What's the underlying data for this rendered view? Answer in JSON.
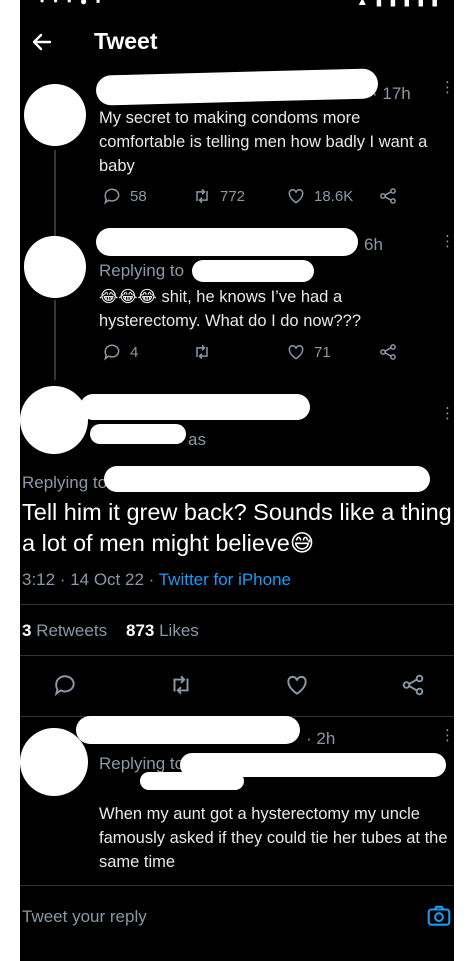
{
  "status_bar": {
    "left": "• • • ⦁ ▪",
    "right": "▲ ▮ ▮ ▮ ▮ ▮"
  },
  "header": {
    "title": "Tweet"
  },
  "tweet1": {
    "time": "· 17h",
    "text": "My secret to making condoms more comfortable is telling men how badly I want a baby",
    "replies": "58",
    "retweets": "772",
    "likes": "18.6K"
  },
  "tweet2": {
    "time": "6h",
    "replying_to": "Replying to",
    "text": "shit, he knows I’ve had a hysterectomy. What do I do now???",
    "emoji": "😂😂😂",
    "replies": "4",
    "likes": "71"
  },
  "focus": {
    "handle_fragment": "as",
    "replying_to": "Replying to",
    "text": "Tell him it grew back? Sounds like a thing a lot of men might believe",
    "emoji": "😅",
    "time": "3:12 · 14 Oct 22 ·",
    "source": "Twitter for iPhone",
    "retweets_count": "3",
    "retweets_label": "Retweets",
    "likes_count": "873",
    "likes_label": "Likes"
  },
  "tweet4": {
    "time": "· 2h",
    "replying_to": "Replying to",
    "text": "When my aunt got a hysterectomy my uncle famously asked if they could tie her tubes at the same time"
  },
  "reply_bar": {
    "placeholder": "Tweet your reply"
  },
  "colors": {
    "background": "#000000",
    "accent": "#1d9bf0",
    "muted": "#8b98a5",
    "text": "#e7e9ea"
  }
}
